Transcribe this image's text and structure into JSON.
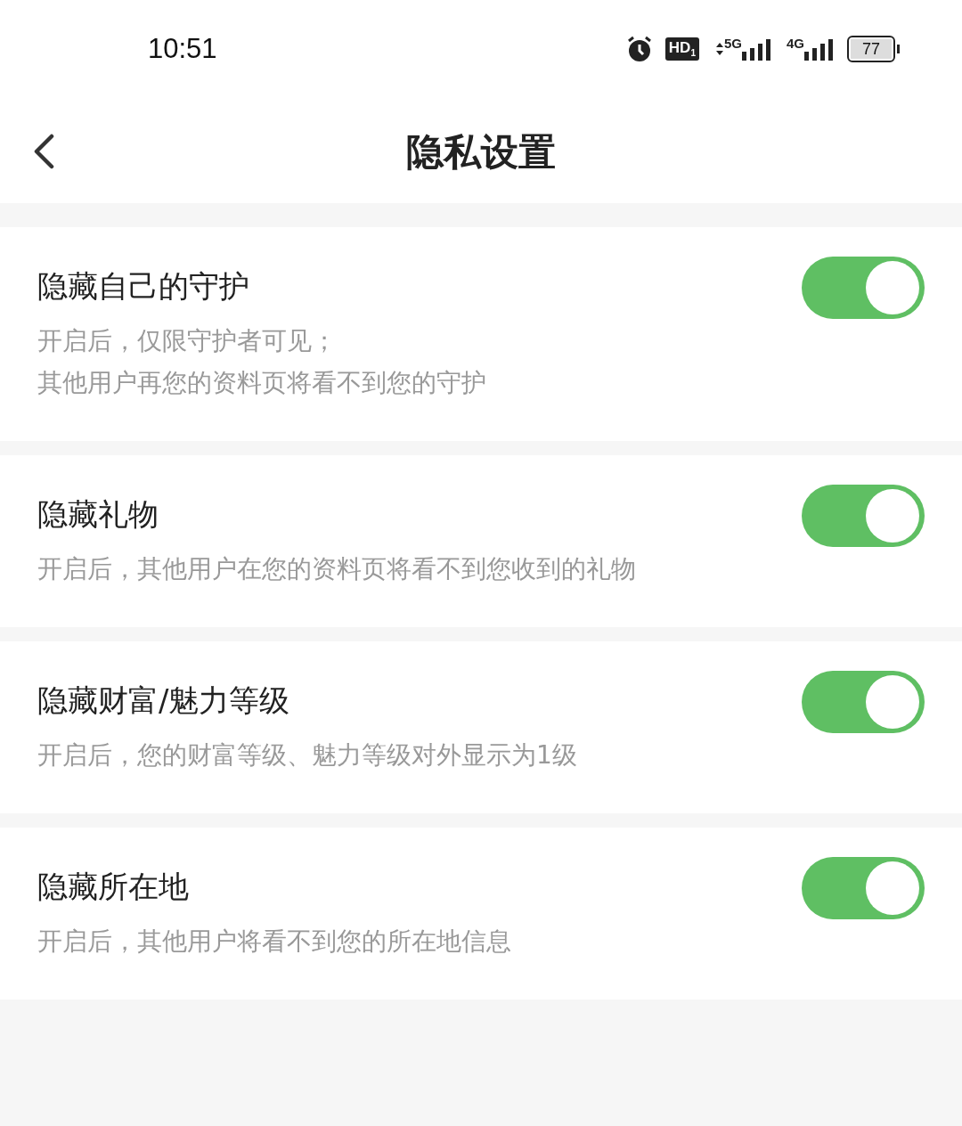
{
  "status_bar": {
    "time": "10:51",
    "hd_label": "HD$_{1}$",
    "network_5g": "5G",
    "network_4g": "4G",
    "battery": "77"
  },
  "header": {
    "title": "隐私设置"
  },
  "settings": [
    {
      "title": "隐藏自己的守护",
      "description": [
        "开启后，仅限守护者可见；",
        "其他用户再您的资料页将看不到您的守护"
      ],
      "on": true
    },
    {
      "title": "隐藏礼物",
      "description": [
        "开启后，其他用户在您的资料页将看不到您收到的礼物"
      ],
      "on": true
    },
    {
      "title": "隐藏财富/魅力等级",
      "description": [
        "开启后，您的财富等级、魅力等级对外显示为1级"
      ],
      "on": true
    },
    {
      "title": "隐藏所在地",
      "description": [
        "开启后，其他用户将看不到您的所在地信息"
      ],
      "on": true
    }
  ]
}
